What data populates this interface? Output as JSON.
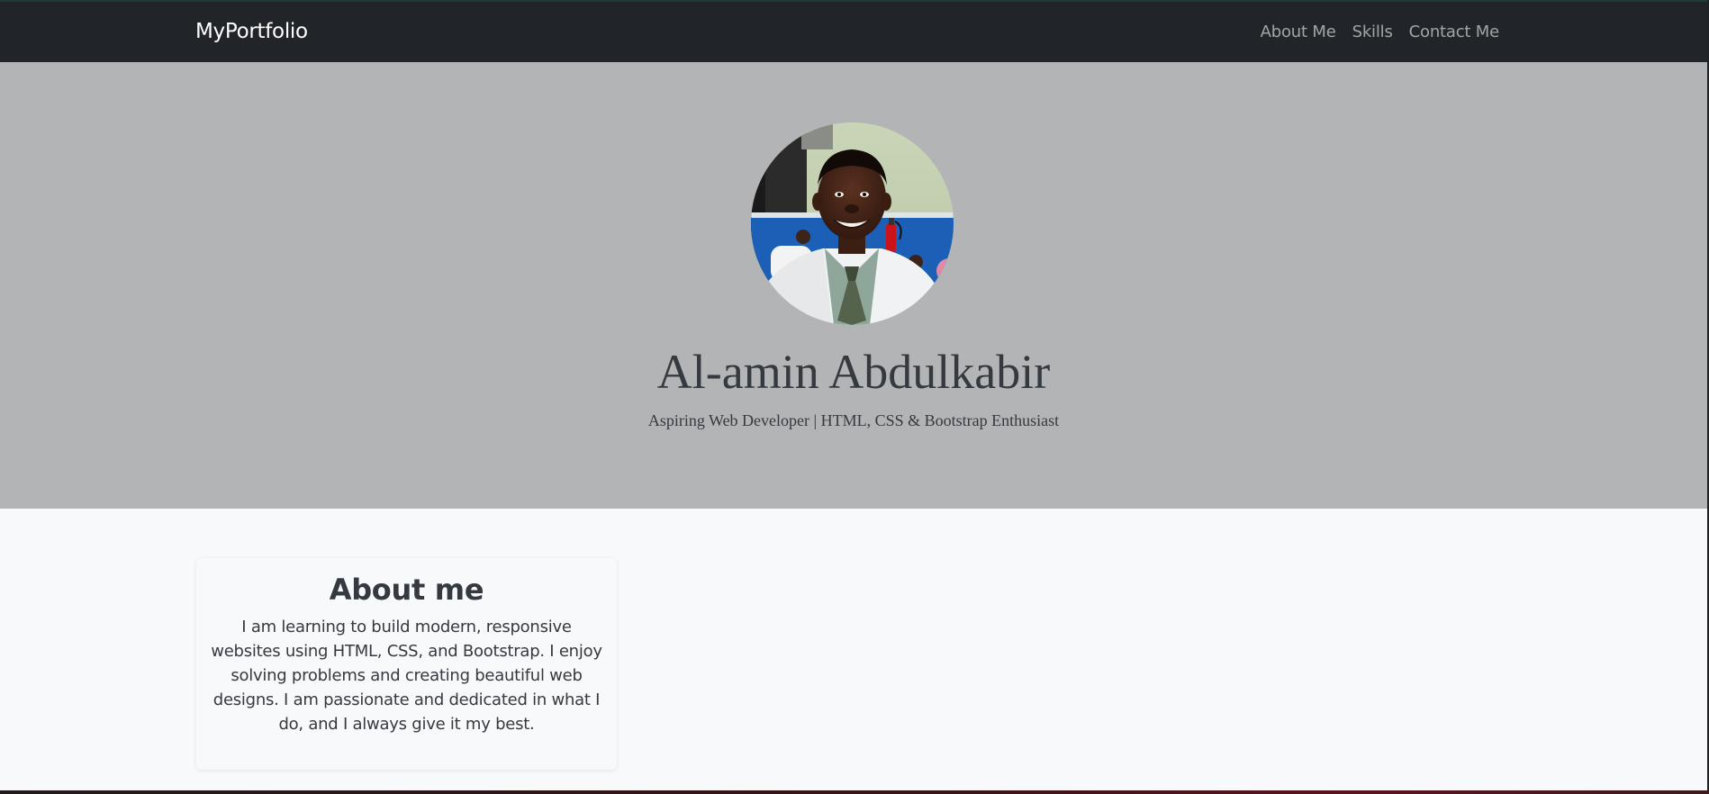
{
  "navbar": {
    "brand": "MyPortfolio",
    "links": [
      "About Me",
      "Skills",
      "Contact Me"
    ]
  },
  "hero": {
    "photo_icon": "profile-photo",
    "name": "Al-amin Abdulkabir",
    "subtitle": "Aspiring Web Developer | HTML, CSS & Bootstrap Enthusiast"
  },
  "about": {
    "title": "About me",
    "text": "I am learning to build modern, responsive websites using HTML, CSS, and Bootstrap. I enjoy solving problems and creating beautiful web designs. I am passionate and dedicated in what I do, and I always give it my best."
  },
  "colors": {
    "navbar_bg": "#212529",
    "hero_bg": "#b3b4b5",
    "page_bg": "#f8f9fa",
    "text_dark": "#343a40"
  }
}
